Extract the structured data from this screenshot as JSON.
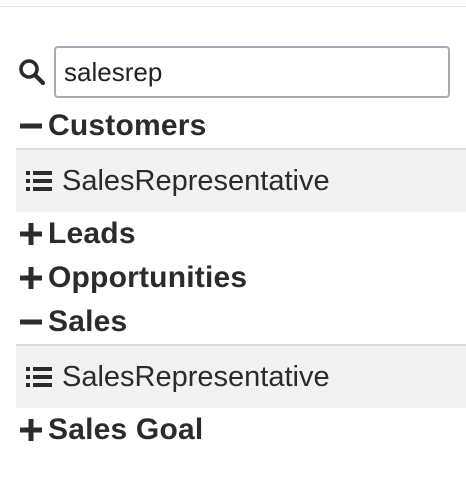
{
  "search": {
    "value": "salesrep",
    "icon": "search-icon"
  },
  "tree": {
    "groups": [
      {
        "label": "Customers",
        "expanded": true,
        "items": [
          "SalesRepresentative"
        ]
      },
      {
        "label": "Leads",
        "expanded": false,
        "items": []
      },
      {
        "label": "Opportunities",
        "expanded": false,
        "items": []
      },
      {
        "label": "Sales",
        "expanded": true,
        "items": [
          "SalesRepresentative"
        ]
      },
      {
        "label": "Sales Goal",
        "expanded": false,
        "items": []
      }
    ],
    "item_icon": "list-icon",
    "expanded_icon": "minus-icon",
    "collapsed_icon": "plus-icon"
  },
  "colors": {
    "text": "#2b2b2b",
    "item_background": "#f2f2f2",
    "input_border": "#a9a9b3"
  }
}
